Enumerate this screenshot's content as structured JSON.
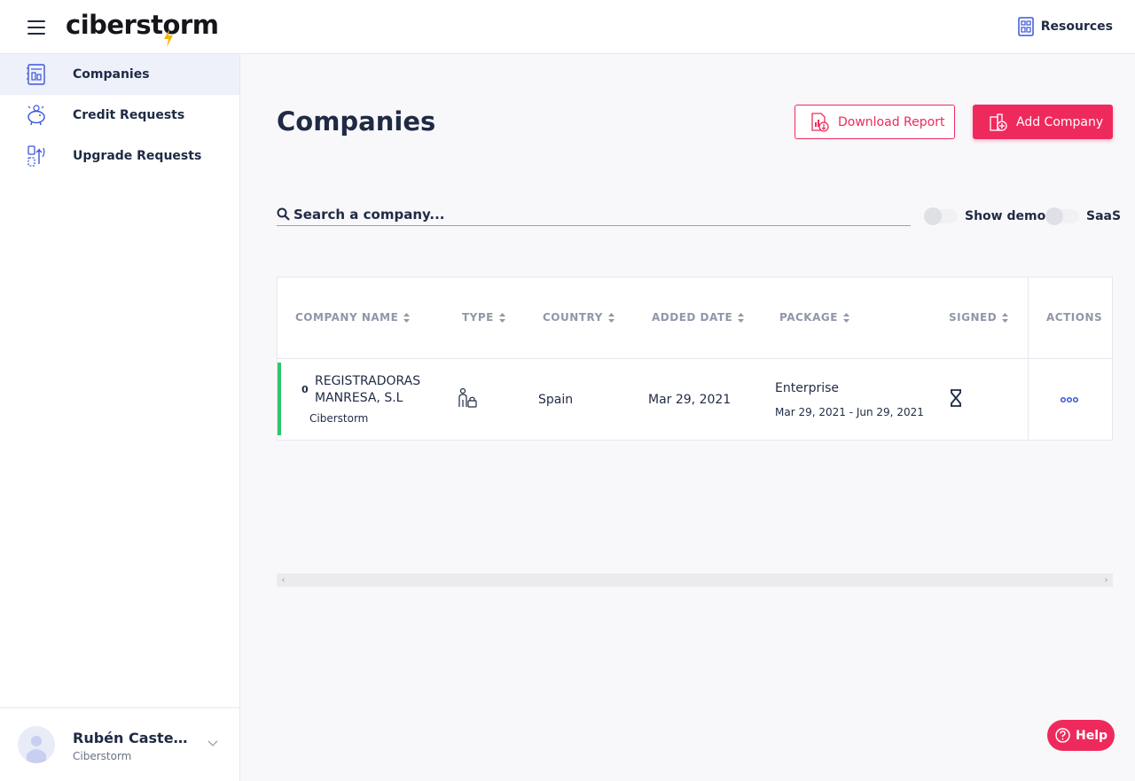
{
  "header": {
    "logo_text": "ciberstorm",
    "resources_label": "Resources"
  },
  "sidebar": {
    "items": [
      {
        "label": "Companies",
        "icon": "companies-icon",
        "active": true
      },
      {
        "label": "Credit Requests",
        "icon": "piggy-bank-icon",
        "active": false
      },
      {
        "label": "Upgrade Requests",
        "icon": "upgrade-icon",
        "active": false
      }
    ],
    "user": {
      "name": "Rubén Castel...",
      "company": "Ciberstorm"
    }
  },
  "main": {
    "title": "Companies",
    "download_label": "Download Report",
    "add_label": "Add Company",
    "search_placeholder": "Search a company...",
    "toggles": {
      "demo_label": "Show demo",
      "saas_label": "SaaS"
    },
    "table": {
      "columns": [
        "COMPANY NAME",
        "TYPE",
        "COUNTRY",
        "ADDED DATE",
        "PACKAGE",
        "SIGNED",
        "ACTIONS"
      ],
      "rows": [
        {
          "count": "0",
          "name": "REGISTRADORAS MANRESA, S.L",
          "partner": "Ciberstorm",
          "type_icon": "person-lock-icon",
          "country": "Spain",
          "added_date": "Mar 29, 2021",
          "package": "Enterprise",
          "package_dates": "Mar 29, 2021 - Jun 29, 2021",
          "signed_icon": "hourglass-icon",
          "status_color": "#2ec56b"
        }
      ]
    }
  },
  "help_label": "Help",
  "colors": {
    "accent": "#ee2a5c",
    "primary_text": "#1f2a44",
    "icon_blue": "#3b55d9",
    "status_green": "#2ec56b"
  }
}
